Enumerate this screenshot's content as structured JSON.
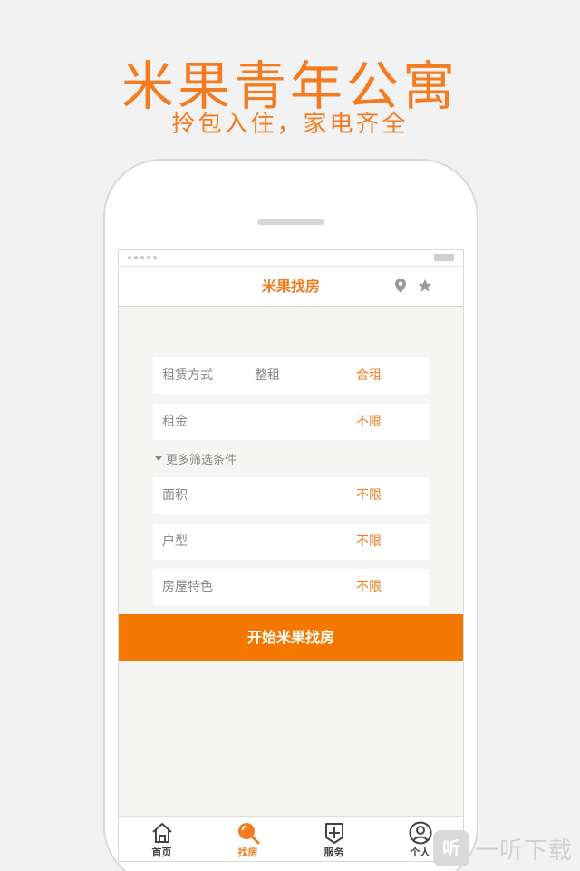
{
  "hero": {
    "title": "米果青年公寓",
    "subtitle": "拎包入住，家电齐全"
  },
  "app": {
    "nav_title": "米果找房",
    "icons": {
      "location": "location-pin-icon",
      "favorite": "star-icon"
    },
    "accent_color": "#f47c20"
  },
  "filters": {
    "rent_type": {
      "label": "租赁方式",
      "options": [
        "整租",
        "合租"
      ],
      "selected": "合租"
    },
    "rent": {
      "label": "租金",
      "value": "不限"
    },
    "more_label": "更多筛选条件",
    "area": {
      "label": "面积",
      "value": "不限"
    },
    "layout": {
      "label": "户型",
      "value": "不限"
    },
    "features": {
      "label": "房屋特色",
      "value": "不限"
    }
  },
  "start_button": "开始米果找房",
  "tabs": [
    {
      "label": "首页",
      "icon": "home-icon",
      "active": false
    },
    {
      "label": "找房",
      "icon": "search-icon",
      "active": true
    },
    {
      "label": "服务",
      "icon": "plus-icon",
      "active": false
    },
    {
      "label": "个人",
      "icon": "user-icon",
      "active": false
    }
  ],
  "watermark": {
    "logo": "听",
    "text": "一听下载"
  }
}
